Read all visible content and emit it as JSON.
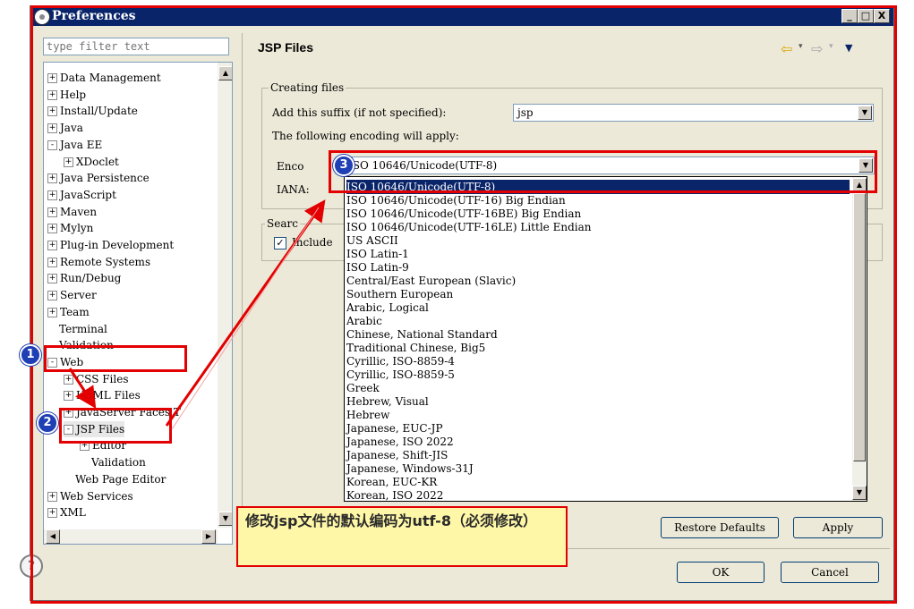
{
  "window": {
    "title": "Preferences",
    "minimize": "_",
    "maximize": "□",
    "close": "X"
  },
  "filter": {
    "placeholder": "type filter text",
    "value": ""
  },
  "tree": {
    "items": [
      {
        "label": "Data Management",
        "expander": "+"
      },
      {
        "label": "Help",
        "expander": "+"
      },
      {
        "label": "Install/Update",
        "expander": "+"
      },
      {
        "label": "Java",
        "expander": "+"
      },
      {
        "label": "Java EE",
        "expander": "-"
      },
      {
        "label": "XDoclet",
        "expander": "+"
      },
      {
        "label": "Java Persistence",
        "expander": "+"
      },
      {
        "label": "JavaScript",
        "expander": "+"
      },
      {
        "label": "Maven",
        "expander": "+"
      },
      {
        "label": "Mylyn",
        "expander": "+"
      },
      {
        "label": "Plug-in Development",
        "expander": "+"
      },
      {
        "label": "Remote Systems",
        "expander": "+"
      },
      {
        "label": "Run/Debug",
        "expander": "+"
      },
      {
        "label": "Server",
        "expander": "+"
      },
      {
        "label": "Team",
        "expander": "+"
      },
      {
        "label": "Terminal",
        "expander": ""
      },
      {
        "label": "Validation",
        "expander": ""
      },
      {
        "label": "Web",
        "expander": "-"
      },
      {
        "label": "CSS Files",
        "expander": "+"
      },
      {
        "label": "HTML Files",
        "expander": "+"
      },
      {
        "label": "JavaServer Faces T",
        "expander": "+"
      },
      {
        "label": "JSP Files",
        "expander": "-"
      },
      {
        "label": "Editor",
        "expander": "+"
      },
      {
        "label": "Validation",
        "expander": ""
      },
      {
        "label": "Web Page Editor",
        "expander": ""
      },
      {
        "label": "Web Services",
        "expander": "+"
      },
      {
        "label": "XML",
        "expander": "+"
      }
    ]
  },
  "page": {
    "title": "JSP Files",
    "nav": {
      "back": "⇦",
      "forward": "⇨",
      "menu": "▼",
      "dropdown": "▾"
    },
    "creating_files": {
      "legend": "Creating files",
      "suffix_label": "Add this suffix (if not specified):",
      "suffix_value": "jsp",
      "encoding_note": "The following encoding will apply:",
      "encoding_label": "Enco",
      "encoding_value": "ISO 10646/Unicode(UTF-8)",
      "iana_label": "IANA:"
    },
    "search": {
      "legend": "Searc",
      "include_label": "Include",
      "include_checked": "✓"
    },
    "encoding_options": [
      "ISO 10646/Unicode(UTF-8)",
      "ISO 10646/Unicode(UTF-16) Big Endian",
      "ISO 10646/Unicode(UTF-16BE) Big Endian",
      "ISO 10646/Unicode(UTF-16LE) Little Endian",
      "US ASCII",
      "ISO Latin-1",
      "ISO Latin-9",
      "Central/East European (Slavic)",
      "Southern European",
      "Arabic, Logical",
      "Arabic",
      "Chinese, National Standard",
      "Traditional Chinese, Big5",
      "Cyrillic, ISO-8859-4",
      "Cyrillic, ISO-8859-5",
      "Greek",
      "Hebrew, Visual",
      "Hebrew",
      "Japanese, EUC-JP",
      "Japanese, ISO 2022",
      "Japanese, Shift-JIS",
      "Japanese, Windows-31J",
      "Korean, EUC-KR",
      "Korean, ISO 2022"
    ],
    "restore_defaults": "Restore Defaults",
    "apply": "Apply"
  },
  "footer": {
    "help": "?",
    "ok": "OK",
    "cancel": "Cancel"
  },
  "annotation": {
    "note": "修改jsp文件的默认编码为utf-8（必须修改）",
    "step1": "1",
    "step2": "2",
    "step3": "3",
    "highlight_color": "#e30000",
    "badge_color": "#1f3fb4"
  }
}
